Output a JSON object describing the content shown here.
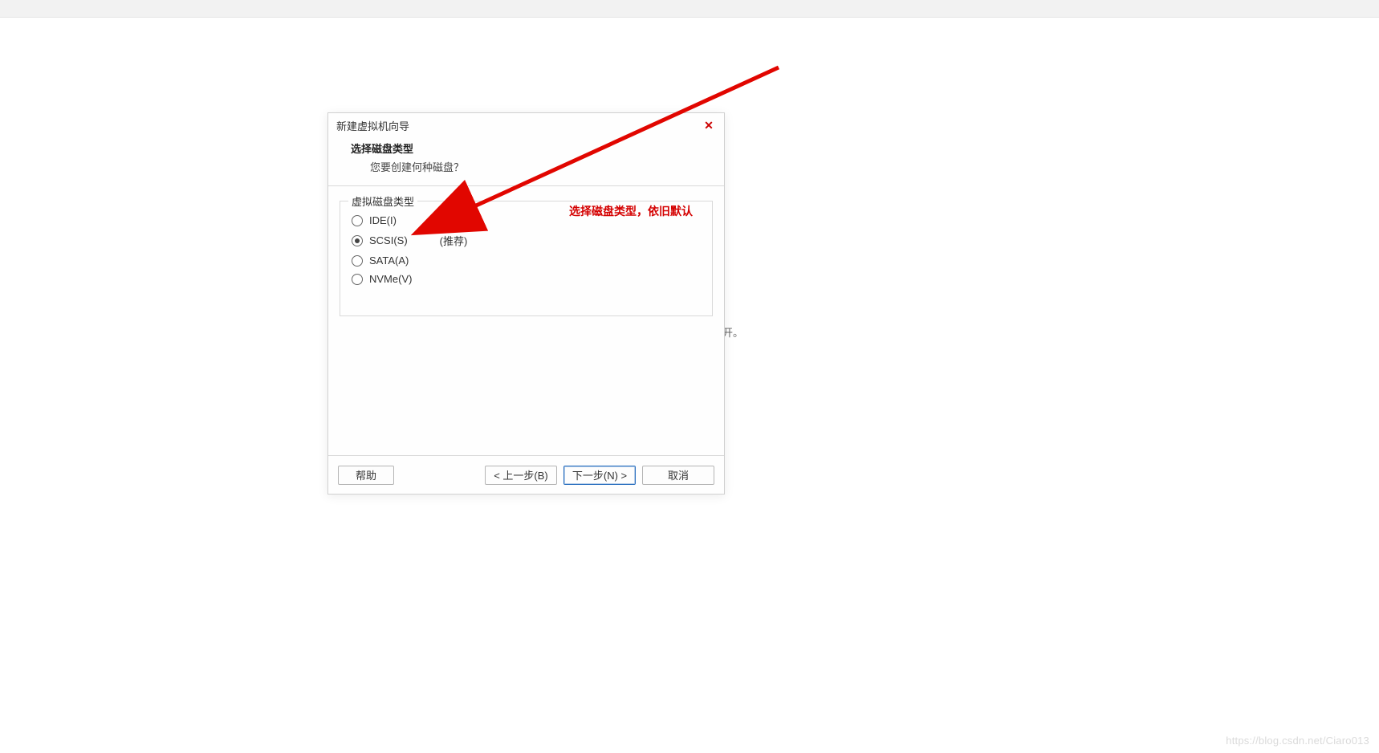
{
  "dialog": {
    "title": "新建虚拟机向导",
    "close_glyph": "✕",
    "header_title": "选择磁盘类型",
    "header_sub": "您要创建何种磁盘？"
  },
  "group": {
    "legend": "虚拟磁盘类型",
    "options": {
      "ide": {
        "label": "IDE(I)",
        "selected": false
      },
      "scsi": {
        "label": "SCSI(S)",
        "selected": true,
        "recommend": "(推荐)"
      },
      "sata": {
        "label": "SATA(A)",
        "selected": false
      },
      "nvme": {
        "label": "NVMe(V)",
        "selected": false
      }
    }
  },
  "annotation": "选择磁盘类型，依旧默认",
  "buttons": {
    "help": "帮助",
    "back": "< 上一步(B)",
    "next": "下一步(N) >",
    "cancel": "取消"
  },
  "bg_text": "开。",
  "watermark": "https://blog.csdn.net/Ciaro013"
}
